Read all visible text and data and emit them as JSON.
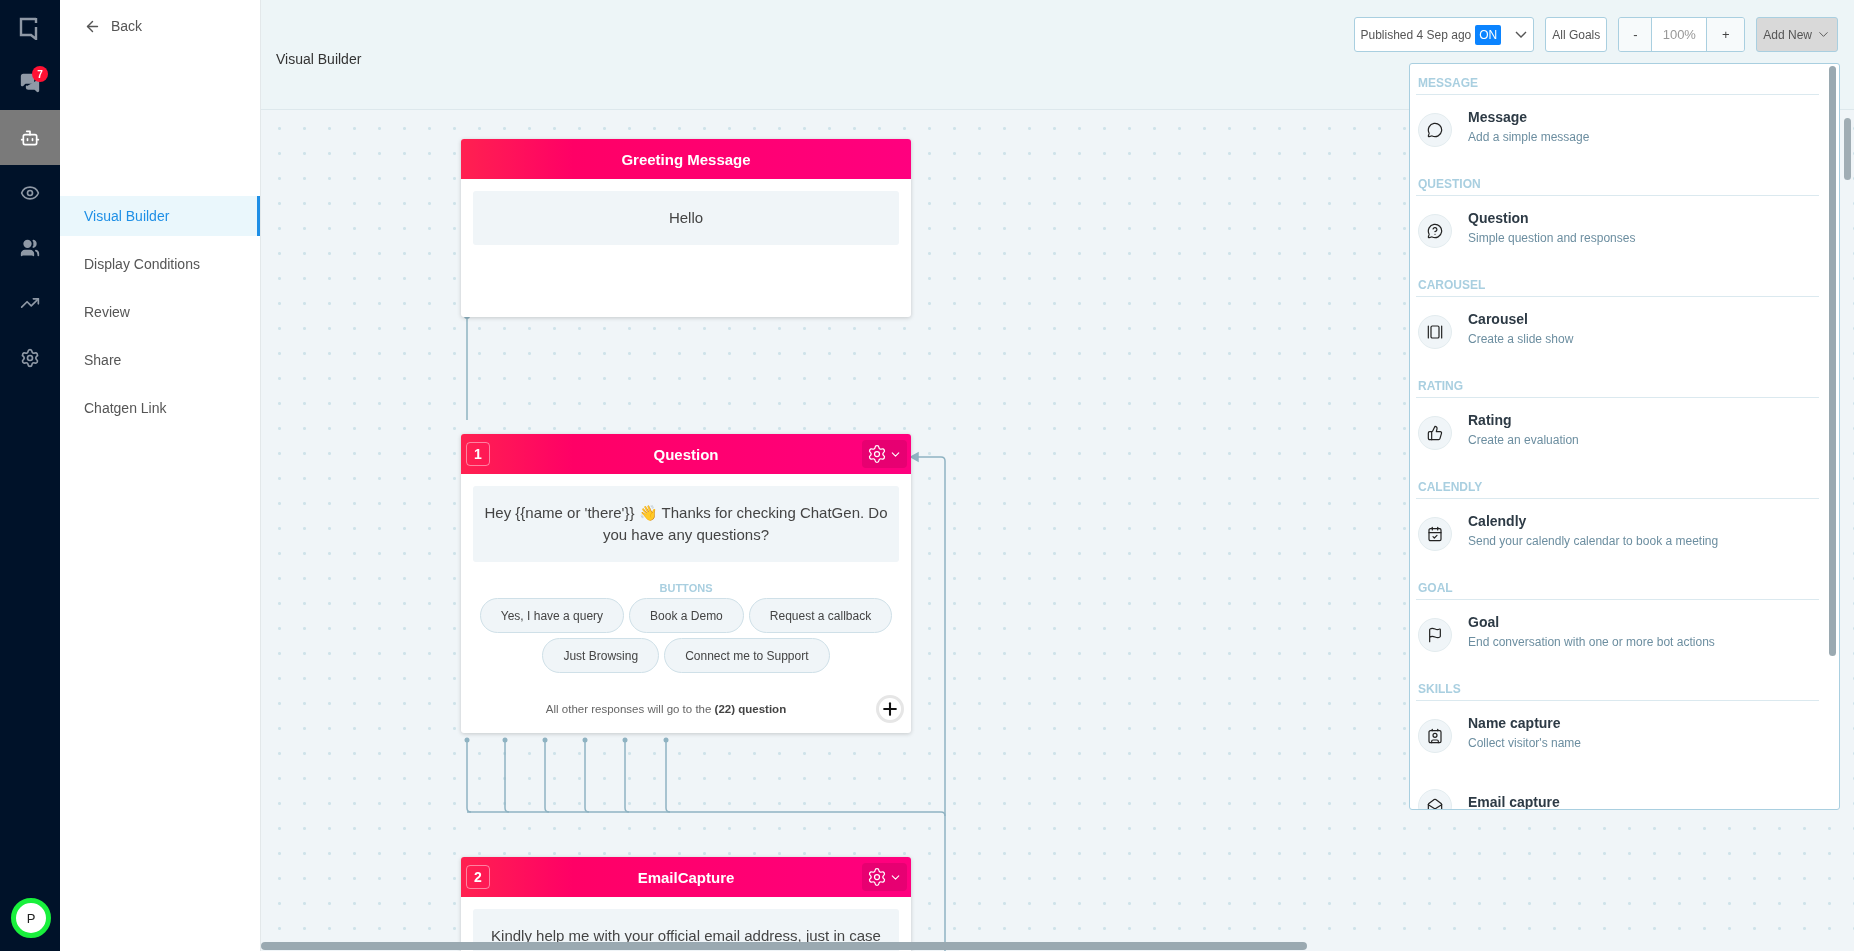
{
  "rail": {
    "items": [
      {
        "kind": "logo",
        "selected": false
      },
      {
        "kind": "chats",
        "selected": false,
        "badge": "7"
      },
      {
        "kind": "bot",
        "selected": true
      },
      {
        "kind": "eye",
        "selected": false
      },
      {
        "kind": "team",
        "selected": false
      },
      {
        "kind": "analytics",
        "selected": false
      },
      {
        "kind": "settings",
        "selected": false
      }
    ],
    "avatar": "P"
  },
  "sidebar": {
    "back": "Back",
    "items": [
      {
        "label": "Visual Builder",
        "selected": true
      },
      {
        "label": "Display Conditions",
        "selected": false
      },
      {
        "label": "Review",
        "selected": false
      },
      {
        "label": "Share",
        "selected": false
      },
      {
        "label": "Chatgen Link",
        "selected": false
      }
    ]
  },
  "header": {
    "title": "Visual Builder",
    "publish": {
      "label": "Published 4 Sep ago",
      "status": "ON"
    },
    "goals": "All Goals",
    "zoom": {
      "minus": "-",
      "value": "100%",
      "plus": "+"
    },
    "add_new": {
      "label": "Add New",
      "expanded": true
    }
  },
  "add_menu": {
    "groups": [
      {
        "heading": "MESSAGE",
        "items": [
          {
            "kind": "message",
            "title": "Message",
            "description": "Add a simple message"
          }
        ]
      },
      {
        "heading": "QUESTION",
        "items": [
          {
            "kind": "question",
            "title": "Question",
            "description": "Simple question and responses"
          }
        ]
      },
      {
        "heading": "CAROUSEL",
        "items": [
          {
            "kind": "carousel",
            "title": "Carousel",
            "description": "Create a slide show"
          }
        ]
      },
      {
        "heading": "RATING",
        "items": [
          {
            "kind": "rating",
            "title": "Rating",
            "description": "Create an evaluation"
          }
        ]
      },
      {
        "heading": "CALENDLY",
        "items": [
          {
            "kind": "calendly",
            "title": "Calendly",
            "description": "Send your calendly calendar to book a meeting"
          }
        ]
      },
      {
        "heading": "GOAL",
        "items": [
          {
            "kind": "goal",
            "title": "Goal",
            "description": "End conversation with one or more bot actions"
          }
        ]
      },
      {
        "heading": "SKILLS",
        "items": [
          {
            "kind": "name",
            "title": "Name capture",
            "description": "Collect visitor's name"
          },
          {
            "kind": "email",
            "title": "Email capture"
          }
        ]
      }
    ]
  },
  "canvas": {
    "nodes": [
      {
        "kind": "greeting",
        "title": "Greeting Message",
        "message": "Hello"
      },
      {
        "kind": "question",
        "number": "1",
        "title": "Question",
        "message": "Hey {{name or 'there'}} 👋 Thanks for checking ChatGen. Do you have any questions?",
        "buttons_label": "BUTTONS",
        "buttons": [
          "Yes, I have a query",
          "Book a Demo",
          "Request a callback",
          "Just Browsing",
          "Connect me to Support"
        ],
        "fallback": "All other responses will go to the **(22) question**"
      },
      {
        "kind": "question",
        "number": "2",
        "title": "EmailCapture",
        "message": "Kindly help me with your official email address, just in case"
      }
    ]
  }
}
